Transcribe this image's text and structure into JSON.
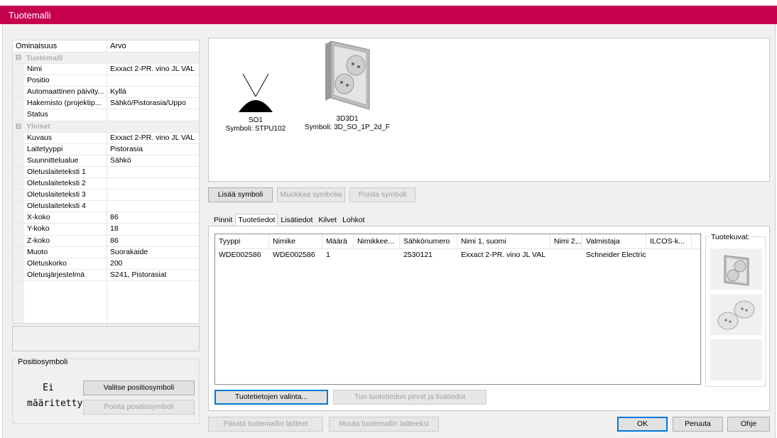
{
  "window": {
    "title": "Tuotemalli"
  },
  "propgrid": {
    "col_property": "Ominaisuus",
    "col_value": "Arvo",
    "categories": [
      {
        "name": "Tuotemalli",
        "rows": [
          {
            "key": "Nimi",
            "value": "Exxact 2-PR. vino JL VAL"
          },
          {
            "key": "Positio",
            "value": ""
          },
          {
            "key": "Automaattinen päivity...",
            "value": "Kyllä"
          },
          {
            "key": "Hakemisto (projektip...",
            "value": "Sähkö/Pistorasia/Uppo"
          },
          {
            "key": "Status",
            "value": ""
          }
        ]
      },
      {
        "name": "Yleiset",
        "rows": [
          {
            "key": "Kuvaus",
            "value": "Exxact 2-PR. vino JL VAL"
          },
          {
            "key": "Laitetyyppi",
            "value": "Pistorasia"
          },
          {
            "key": "Suunnittelualue",
            "value": "Sähkö"
          },
          {
            "key": "Oletuslaiteteksti 1",
            "value": ""
          },
          {
            "key": "Oletuslaiteteksti 2",
            "value": ""
          },
          {
            "key": "Oletuslaiteteksti 3",
            "value": ""
          },
          {
            "key": "Oletuslaiteteksti 4",
            "value": ""
          },
          {
            "key": "X-koko",
            "value": "86"
          },
          {
            "key": "Y-koko",
            "value": "18"
          },
          {
            "key": "Z-koko",
            "value": "86"
          },
          {
            "key": "Muoto",
            "value": "Suorakaide"
          },
          {
            "key": "Oletuskorko",
            "value": "200"
          },
          {
            "key": "Oletusjärjestelmä",
            "value": "S241, Pistorasiat"
          }
        ]
      }
    ]
  },
  "position_symbol": {
    "legend": "Positiosymboli",
    "status_line1": "Ei",
    "status_line2": "määritetty",
    "select_label": "Valitse positiosymboli",
    "remove_label": "Poista positiosymboli"
  },
  "symbols": [
    {
      "name": "SO1",
      "symbol_label": "Symboli: STPU102",
      "icon": "socket-symbol-icon"
    },
    {
      "name": "3D3D1",
      "symbol_label": "Symboli: 3D_SO_1P_2d_F",
      "icon": "socket-3d-icon"
    }
  ],
  "symbol_buttons": {
    "add": "Lisää symboli",
    "edit": "Muokkaa symbolia",
    "remove": "Poista symboli"
  },
  "tabs": [
    {
      "label": "Pinnit",
      "active": false
    },
    {
      "label": "Tuotetiedot",
      "active": true
    },
    {
      "label": "Lisätiedot",
      "active": false
    },
    {
      "label": "Kilvet",
      "active": false
    },
    {
      "label": "Lohkot",
      "active": false
    }
  ],
  "product_table": {
    "columns": [
      "Tyyppi",
      "Nimike",
      "Määrä",
      "Nimikkee...",
      "Sähkönumero",
      "Nimi 1, suomi",
      "Nimi 2,...",
      "Valmistaja",
      "ILCOS-k..."
    ],
    "rows": [
      [
        "WDE002586",
        "WDE002586",
        "1",
        "",
        "2530121",
        "Exxact 2-PR. vino JL VAL",
        "",
        "Schneider Electric",
        ""
      ]
    ]
  },
  "product_images": {
    "legend": "Tuotekuvat:",
    "images": [
      "socket-front-icon",
      "socket-angled-icon",
      "empty-image"
    ]
  },
  "panel_buttons": {
    "select_product_data": "Tuotetietojen valinta...",
    "import_pins": "Tuo tuotetiedon pinnit ja lisätiedot"
  },
  "footer_buttons": {
    "update_devices": "Päivitä tuotemallin laitteet",
    "convert_devices": "Muuta tuotemallin laitteeksi",
    "ok": "OK",
    "cancel": "Peruuta",
    "help": "Ohje"
  },
  "colors": {
    "titlebar": "#c4004f",
    "focus": "#0078d7"
  }
}
